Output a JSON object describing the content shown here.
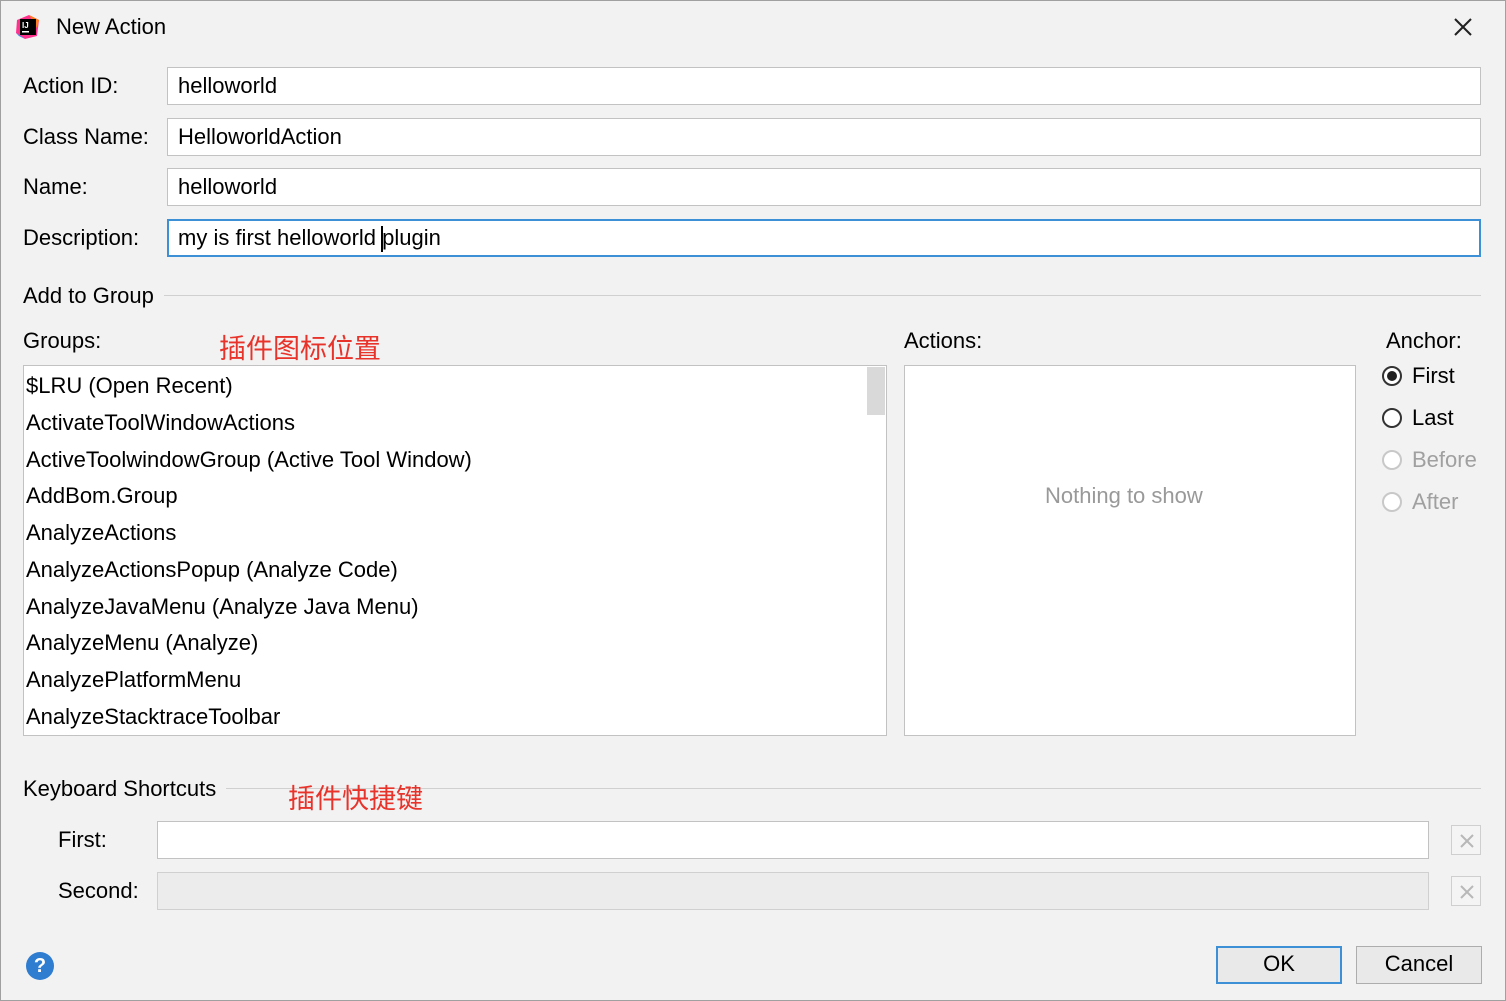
{
  "window": {
    "title": "New Action",
    "icon": "intellij-idea-icon",
    "close_icon": "close-icon"
  },
  "form": {
    "action_id": {
      "label": "Action ID:",
      "value": "helloworld"
    },
    "class_name": {
      "label": "Class Name:",
      "value": "HelloworldAction"
    },
    "name": {
      "label": "Name:",
      "value": "helloworld"
    },
    "description": {
      "label": "Description:",
      "value_before_caret": "my is first helloworld ",
      "value_after_caret": "plugin"
    }
  },
  "add_to_group": {
    "section_title": "Add to Group",
    "groups_label": "Groups:",
    "groups_annotation": "插件图标位置",
    "groups": [
      "$LRU (Open Recent)",
      "ActivateToolWindowActions",
      "ActiveToolwindowGroup (Active Tool Window)",
      "AddBom.Group",
      "AnalyzeActions",
      "AnalyzeActionsPopup (Analyze Code)",
      "AnalyzeJavaMenu (Analyze Java Menu)",
      "AnalyzeMenu (Analyze)",
      "AnalyzePlatformMenu",
      "AnalyzeStacktraceToolbar"
    ],
    "actions_label": "Actions:",
    "actions_empty_text": "Nothing to show",
    "anchor_label": "Anchor:",
    "anchors": [
      {
        "label": "First",
        "checked": true,
        "enabled": true
      },
      {
        "label": "Last",
        "checked": false,
        "enabled": true
      },
      {
        "label": "Before",
        "checked": false,
        "enabled": false
      },
      {
        "label": "After",
        "checked": false,
        "enabled": false
      }
    ]
  },
  "keyboard_shortcuts": {
    "section_title": "Keyboard Shortcuts",
    "annotation": "插件快捷键",
    "first": {
      "label": "First:",
      "value": ""
    },
    "second": {
      "label": "Second:",
      "value": ""
    }
  },
  "buttons": {
    "help": "?",
    "ok": "OK",
    "cancel": "Cancel"
  },
  "colors": {
    "focus_border": "#3d8fd6",
    "annotation": "#e8332b",
    "help_icon": "#2f7dd1"
  }
}
